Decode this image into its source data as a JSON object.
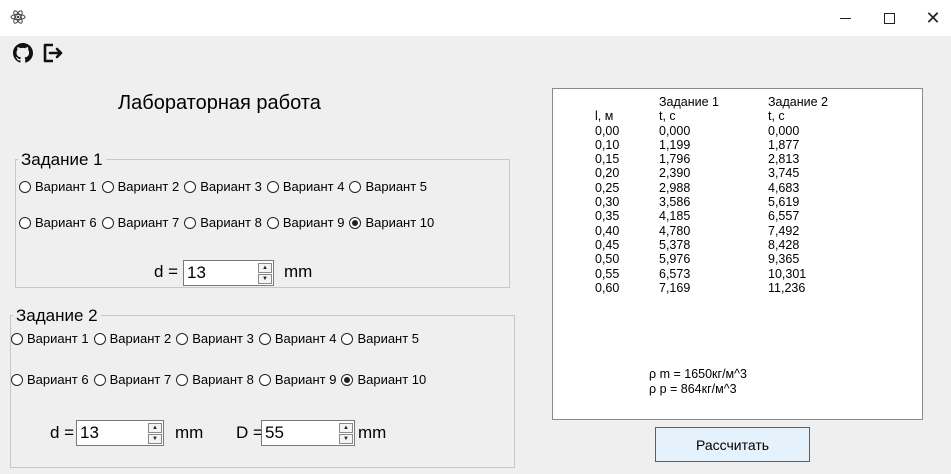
{
  "window": {
    "app_icon": "atom-icon",
    "minimize_glyph": "—",
    "maximize_glyph": "☐",
    "close_glyph": "✕"
  },
  "toolbar": {
    "icons": [
      "github-icon",
      "exit-icon"
    ]
  },
  "title": "Лабораторная работа",
  "task1": {
    "legend": "Задание 1",
    "variants": [
      "Вариант 1",
      "Вариант 2",
      "Вариант 3",
      "Вариант 4",
      "Вариант 5",
      "Вариант 6",
      "Вариант 7",
      "Вариант 8",
      "Вариант 9",
      "Вариант 10"
    ],
    "selected": "Вариант 10",
    "d_label": "d =",
    "d_value": "13",
    "d_unit": "mm"
  },
  "task2": {
    "legend": "Задание 2",
    "variants": [
      "Вариант 1",
      "Вариант 2",
      "Вариант 3",
      "Вариант 4",
      "Вариант 5",
      "Вариант 6",
      "Вариант 7",
      "Вариант 8",
      "Вариант 9",
      "Вариант 10"
    ],
    "selected": "Вариант 10",
    "d_label": "d =",
    "d_value": "13",
    "d_unit": "mm",
    "D_label": "D =",
    "D_value": "55",
    "D_unit": "mm"
  },
  "results": {
    "header_task1": "Задание 1",
    "header_task2": "Задание 2",
    "col_l": "l, м",
    "col_t1": "t, c",
    "col_t2": "t, c",
    "l": [
      "0,00",
      "0,10",
      "0,15",
      "0,20",
      "0,25",
      "0,30",
      "0,35",
      "0,40",
      "0,45",
      "0,50",
      "0,55",
      "0,60"
    ],
    "t1": [
      "0,000",
      "1,199",
      "1,796",
      "2,390",
      "2,988",
      "3,586",
      "4,185",
      "4,780",
      "5,378",
      "5,976",
      "6,573",
      "7,169"
    ],
    "t2": [
      "0,000",
      "1,877",
      "2,813",
      "3,745",
      "4,683",
      "5,619",
      "6,557",
      "7,492",
      "8,428",
      "9,365",
      "10,301",
      "11,236"
    ],
    "rho_m": "ρ m = 1650кг/м^3",
    "rho_p": "ρ p = 864кг/м^3"
  },
  "calculate_button": "Рассчитать"
}
